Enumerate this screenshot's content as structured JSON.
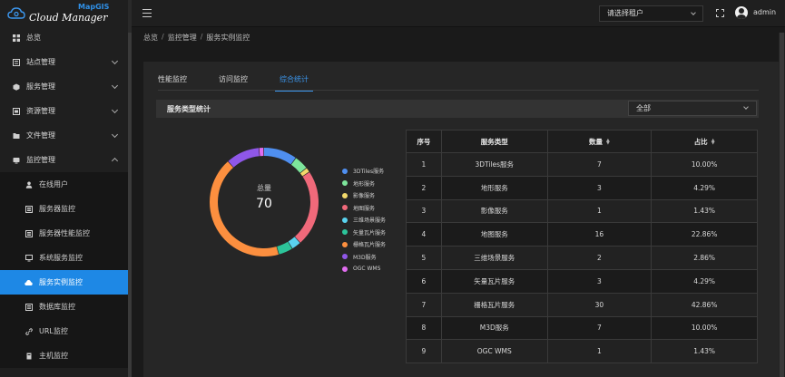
{
  "app": {
    "brand": "Cloud Manager",
    "brand_sub": "MapGIS"
  },
  "sidebar": {
    "items": [
      {
        "label": "总览",
        "icon": "grid-icon"
      },
      {
        "label": "站点管理",
        "icon": "site-icon"
      },
      {
        "label": "服务管理",
        "icon": "cube-icon"
      },
      {
        "label": "资源管理",
        "icon": "resource-icon"
      },
      {
        "label": "文件管理",
        "icon": "folder-icon"
      },
      {
        "label": "监控管理",
        "icon": "monitor-icon"
      }
    ],
    "sub_items": [
      {
        "label": "在线用户",
        "icon": "user-icon"
      },
      {
        "label": "服务器监控",
        "icon": "server-icon"
      },
      {
        "label": "服务器性能监控",
        "icon": "server-perf-icon"
      },
      {
        "label": "系统服务监控",
        "icon": "system-icon"
      },
      {
        "label": "服务实例监控",
        "icon": "cloud-icon"
      },
      {
        "label": "数据库监控",
        "icon": "database-icon"
      },
      {
        "label": "URL监控",
        "icon": "link-icon"
      },
      {
        "label": "主机监控",
        "icon": "host-icon"
      }
    ]
  },
  "header": {
    "tenant_placeholder": "请选择租户",
    "username": "admin"
  },
  "breadcrumb": [
    "总览",
    "监控管理",
    "服务实例监控"
  ],
  "tabs": [
    {
      "label": "性能监控"
    },
    {
      "label": "访问监控"
    },
    {
      "label": "综合统计"
    }
  ],
  "section": {
    "title": "服务类型统计",
    "filter_value": "全部"
  },
  "donut": {
    "label": "总量",
    "total": "70"
  },
  "colors": {
    "accent": "#1e88e5"
  },
  "chart_data": {
    "type": "pie",
    "categories": [
      "3DTiles服务",
      "地形服务",
      "影像服务",
      "地图服务",
      "三维场景服务",
      "矢量瓦片服务",
      "栅格瓦片服务",
      "M3D服务",
      "OGC WMS"
    ],
    "values": [
      7,
      3,
      1,
      16,
      2,
      3,
      30,
      7,
      1
    ],
    "colors": [
      "#4f8ff0",
      "#7de59b",
      "#f2d96b",
      "#f0697a",
      "#5ad3ef",
      "#2cc49a",
      "#fc8f3f",
      "#8f57e8",
      "#e16df0"
    ],
    "legend_position": "right"
  },
  "table": {
    "headers": [
      "序号",
      "服务类型",
      "数量",
      "占比"
    ],
    "rows": [
      [
        "1",
        "3DTiles服务",
        "7",
        "10.00%"
      ],
      [
        "2",
        "地形服务",
        "3",
        "4.29%"
      ],
      [
        "3",
        "影像服务",
        "1",
        "1.43%"
      ],
      [
        "4",
        "地图服务",
        "16",
        "22.86%"
      ],
      [
        "5",
        "三维场景服务",
        "2",
        "2.86%"
      ],
      [
        "6",
        "矢量瓦片服务",
        "3",
        "4.29%"
      ],
      [
        "7",
        "栅格瓦片服务",
        "30",
        "42.86%"
      ],
      [
        "8",
        "M3D服务",
        "7",
        "10.00%"
      ],
      [
        "9",
        "OGC WMS",
        "1",
        "1.43%"
      ]
    ]
  }
}
